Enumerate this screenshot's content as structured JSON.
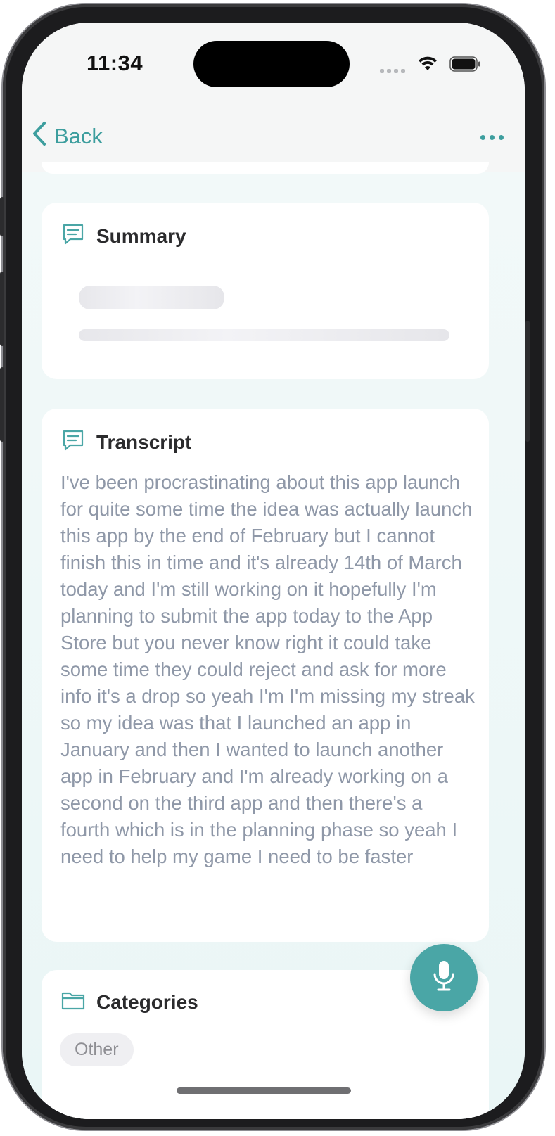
{
  "status_bar": {
    "time": "11:34"
  },
  "nav": {
    "back_label": "Back"
  },
  "summary": {
    "title": "Summary"
  },
  "transcript": {
    "title": "Transcript",
    "text": "I've been procrastinating about this app launch for quite some time the idea was actually launch this app by the end of February but I cannot finish this in time and it's already 14th of March today and I'm still working on it hopefully I'm planning to submit the app today to the App Store but you never know right it could take some time they could reject and ask for more info it's a drop so yeah I'm I'm missing my streak so my idea was that I launched an app in January and then I wanted to launch another app in February and I'm already working on a second on the third app and then there's a fourth which is in the planning phase so yeah I need to help my game I need to be faster"
  },
  "categories": {
    "title": "Categories",
    "items": [
      "Other"
    ]
  },
  "colors": {
    "accent": "#3d9e9e",
    "fab": "#4aa6a6",
    "body_text": "#8f98a8"
  },
  "icons": {
    "back": "chevron-left-icon",
    "more": "ellipsis-icon",
    "summary": "message-icon",
    "transcript": "message-icon",
    "categories": "folder-icon",
    "fab": "microphone-icon"
  }
}
